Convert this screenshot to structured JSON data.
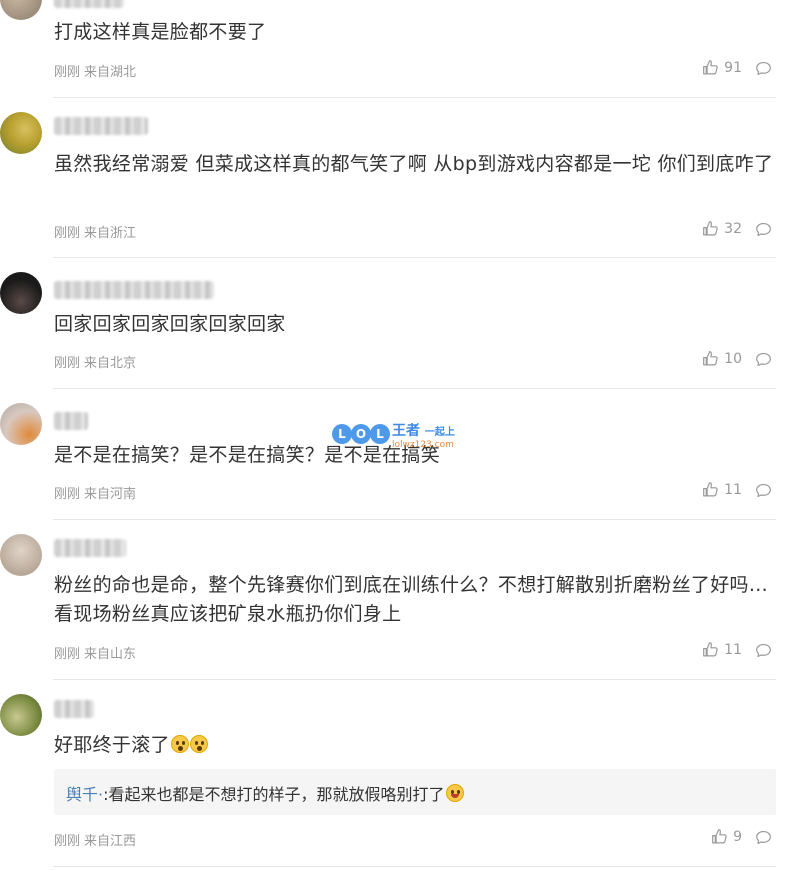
{
  "comments": [
    {
      "text": "打成这样真是脸都不要了",
      "time": "刚刚",
      "location": "来自湖北",
      "likes": "91",
      "avatar_colors": [
        "#8a7a6a",
        "#c9b9a3"
      ]
    },
    {
      "text": "虽然我经常溺爱 但菜成这样真的都气笑了啊 从bp到游戏内容都是一坨 你们到底咋了",
      "time": "刚刚",
      "location": "来自浙江",
      "likes": "32",
      "avatar_colors": [
        "#b8a030",
        "#6d7a2a"
      ]
    },
    {
      "text": "回家回家回家回家回家回家",
      "time": "刚刚",
      "location": "来自北京",
      "likes": "10",
      "avatar_colors": [
        "#1a1a1a",
        "#5a4a48"
      ]
    },
    {
      "text": "是不是在搞笑？是不是在搞笑？是不是在搞笑",
      "time": "刚刚",
      "location": "来自河南",
      "likes": "11",
      "avatar_colors": [
        "#e08a3a",
        "#d8c8c0"
      ]
    },
    {
      "text": "粉丝的命也是命，整个先锋赛你们到底在训练什么？不想打解散别折磨粉丝了好吗…看现场粉丝真应该把矿泉水瓶扔你们身上",
      "time": "刚刚",
      "location": "来自山东",
      "likes": "11",
      "avatar_colors": [
        "#b8a898",
        "#e0d4c8"
      ]
    },
    {
      "text": "好耶终于滚了",
      "time": "刚刚",
      "location": "来自江西",
      "likes": "9",
      "avatar_colors": [
        "#7a8a40",
        "#c8c890"
      ],
      "reply": {
        "author": "舆千·",
        "text": ":看起来也都是不想打的样子，那就放假咯别打了"
      }
    }
  ],
  "watermark": {
    "letters": [
      "L",
      "O",
      "L"
    ],
    "title": "王者",
    "subtitle": "一起上",
    "url": "lolwz123.com"
  },
  "colors": {
    "text": "#333333",
    "meta": "#999999",
    "link": "#4a7fb5",
    "divider": "#e6e6e6",
    "reply_bg": "#f5f5f5"
  },
  "icons": {
    "like": "thumbs-up-icon",
    "reply": "comment-bubble-icon",
    "emoji_fear": "scared-face-emoji",
    "emoji_smile": "smile-face-emoji"
  }
}
